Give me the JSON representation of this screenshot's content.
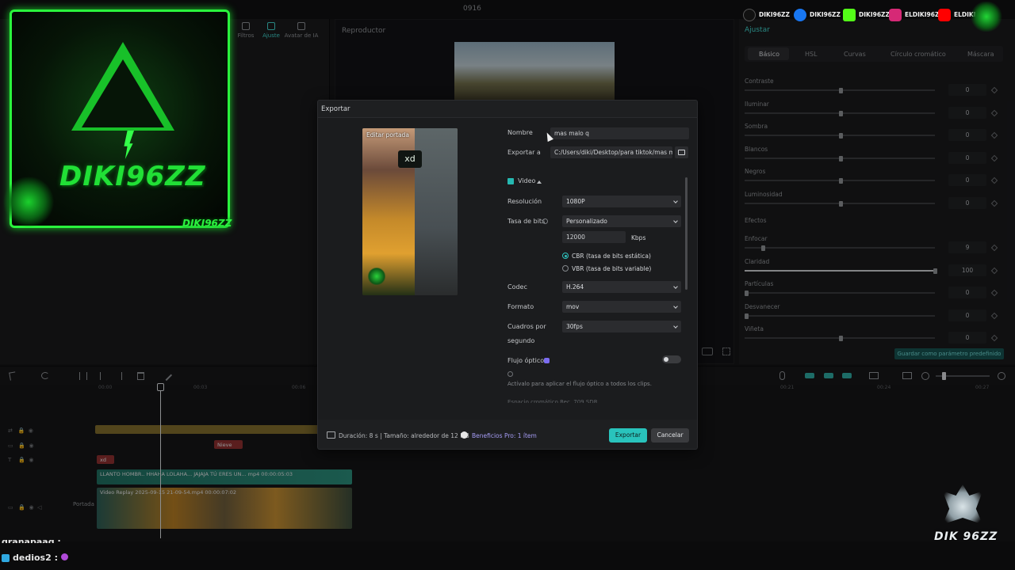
{
  "window": {
    "title": "0916"
  },
  "top_tabs": [
    {
      "label": "Filtros",
      "icon": "filters-icon"
    },
    {
      "label": "Ajuste",
      "icon": "adjust-icon"
    },
    {
      "label": "Avatar de IA",
      "icon": "avatar-icon"
    }
  ],
  "player": {
    "header": "Reproductor"
  },
  "adjust_panel": {
    "title": "Ajustar",
    "tabs": [
      "Básico",
      "HSL",
      "Curvas",
      "Círculo cromático",
      "Máscara"
    ],
    "active_tab": "Básico",
    "rows": [
      {
        "label": "Contraste",
        "value": "0",
        "level": 0.5
      },
      {
        "label": "Iluminar",
        "value": "0",
        "level": 0.5
      },
      {
        "label": "Sombra",
        "value": "0",
        "level": 0.5
      },
      {
        "label": "Blancos",
        "value": "0",
        "level": 0.5
      },
      {
        "label": "Negros",
        "value": "0",
        "level": 0.5
      },
      {
        "label": "Luminosidad",
        "value": "0",
        "level": 0.5
      }
    ],
    "effects_label": "Efectos",
    "effects": [
      {
        "label": "Enfocar",
        "value": "9",
        "level": 0.09
      },
      {
        "label": "Claridad",
        "value": "100",
        "level": 1.0
      },
      {
        "label": "Partículas",
        "value": "0",
        "level": 0.0
      },
      {
        "label": "Desvanecer",
        "value": "0",
        "level": 0.0
      },
      {
        "label": "Viñeta",
        "value": "0",
        "level": 0.5
      }
    ],
    "save_preset": "Guardar como parámetro predefinido"
  },
  "timeline": {
    "ruler": [
      "00:00",
      "00:03",
      "00:06",
      "00:21",
      "00:24",
      "00:27"
    ],
    "clips": {
      "top_audio": "LLANTO HOMBR.. HHAHA LOLAHA... JAJAJA TÚ ERES UN... mp4  00:00:05:03",
      "main_video": "Video   Replay 2025-09-15 21-09-54.mp4   00:00:07:02",
      "text_clip": "xd",
      "red_clip": "Nieve"
    },
    "cover_label": "Portada"
  },
  "export_dialog": {
    "title": "Exportar",
    "cover_edit": "Editar portada",
    "cover_badge": "xd",
    "name_label": "Nombre",
    "name_value": "mas malo q",
    "export_to_label": "Exportar a",
    "export_path": "C:/Users/diki/Desktop/para tiktok/mas m...",
    "video_section": "Video",
    "video_checked": true,
    "resolution_label": "Resolución",
    "resolution_value": "1080P",
    "bitrate_label": "Tasa de bits",
    "bitrate_value": "Personalizado",
    "bitrate_number": "12000",
    "bitrate_unit": "Kbps",
    "cbr_label": "CBR (tasa de bits estática)",
    "vbr_label": "VBR (tasa de bits variable)",
    "codec_label": "Codec",
    "codec_value": "H.264",
    "format_label": "Formato",
    "format_value": "mov",
    "fps_label_1": "Cuadros por",
    "fps_label_2": "segundo",
    "fps_value": "30fps",
    "optical_flow_label": "Flujo óptico",
    "optical_flow_hint": "Actívalo para aplicar el flujo óptico a todos los clips.",
    "color_space_partial": "Espacio cromático   Rec. 709 SDR",
    "footer_info": "Duración: 8 s | Tamaño: alrededor de 12 MB",
    "pro_benefits": "Beneficios Pro: 1 ítem",
    "export_button": "Exportar",
    "cancel_button": "Cancelar"
  },
  "stream_overlay": {
    "logo_name": "DIKI96ZZ",
    "logo_sub": "DIKI96ZZ",
    "socials": [
      {
        "icon": "tiktok-icon",
        "label": "DIKI96ZZ",
        "color": "#111111"
      },
      {
        "icon": "facebook-icon",
        "label": "DIKI96ZZ",
        "color": "#1877f2"
      },
      {
        "icon": "kick-icon",
        "label": "DIKI96ZZ",
        "color": "#53fc18"
      },
      {
        "icon": "instagram-icon",
        "label": "ELDIKI96ZZ",
        "color": "#d62976"
      },
      {
        "icon": "youtube-icon",
        "label": "ELDIKI",
        "color": "#ff0000"
      }
    ],
    "watermark": "DIK 96ZZ"
  },
  "chat": [
    {
      "user": "granapaaq : "
    },
    {
      "user": "dedios2 : "
    }
  ],
  "colors": {
    "accent": "#29c3bc",
    "brand_green": "#21e036"
  }
}
